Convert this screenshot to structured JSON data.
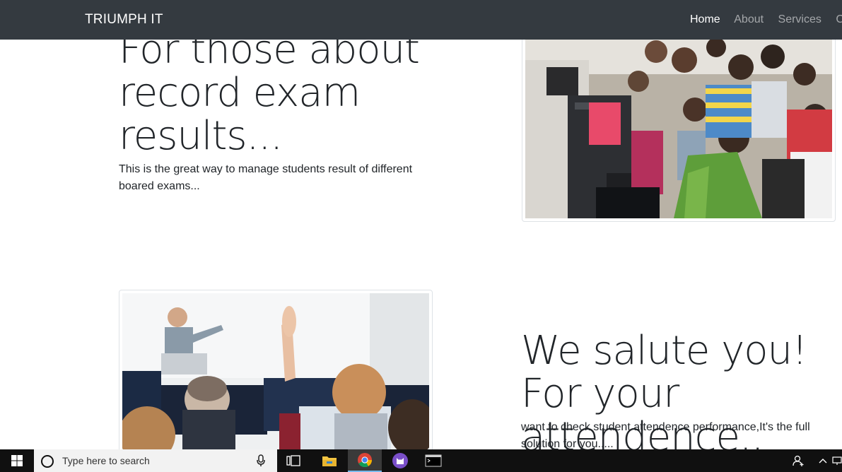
{
  "navbar": {
    "brand": "TRIUMPH IT",
    "links": [
      "Home",
      "About",
      "Services",
      "Cor"
    ]
  },
  "section1": {
    "heading": "For those about record exam results...",
    "text": "This is the great way to manage students result of different boared exams..."
  },
  "section2": {
    "heading": "We salute you! For your attendence..",
    "text": "want to check student attendence performance,It's the full solution for you....."
  },
  "taskbar": {
    "search_placeholder": "Type here to search",
    "icons": [
      "windows-start-icon",
      "cortana-circle-icon",
      "microphone-icon",
      "task-view-icon",
      "file-explorer-icon",
      "chrome-icon",
      "cat-app-icon",
      "terminal-icon",
      "people-icon",
      "chevron-up-icon",
      "network-icon"
    ]
  },
  "colors": {
    "navbar_bg": "#343a40",
    "taskbar_bg": "#101010",
    "text": "#212529"
  }
}
